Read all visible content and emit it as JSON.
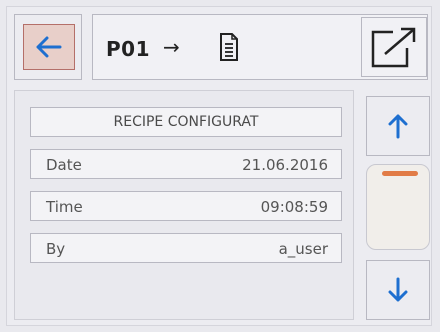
{
  "header": {
    "recipe_code": "P01",
    "arrow_glyph": "→",
    "icons": {
      "back": "arrow-left-icon",
      "document": "document-icon",
      "export": "export-icon"
    }
  },
  "panel": {
    "title": "RECIPE CONFIGURAT",
    "rows": [
      {
        "label": "Date",
        "value": "21.06.2016"
      },
      {
        "label": "Time",
        "value": "09:08:59"
      },
      {
        "label": "By",
        "value": "a_user"
      }
    ]
  },
  "scroll": {
    "up_icon": "arrow-up-icon",
    "down_icon": "arrow-down-icon",
    "position": 0.0
  },
  "colors": {
    "accent_blue": "#1e6fd0",
    "back_fill": "#e8cfc9",
    "back_border": "#b46f69",
    "scroll_thumb": "#e17b46"
  }
}
